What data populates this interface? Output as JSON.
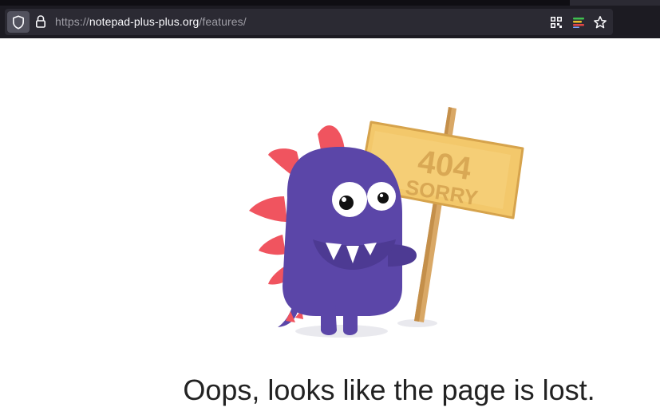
{
  "browser": {
    "url_scheme": "https://",
    "url_host": "notepad-plus-plus.org",
    "url_path": "/features/",
    "icons": {
      "tracking": "shield-icon",
      "secure": "lock-icon",
      "ext1": "qr-code-icon",
      "ext2": "color-bars-icon",
      "bookmark": "star-icon"
    }
  },
  "page": {
    "sign_code": "404",
    "sign_text": "SORRY",
    "message": "Oops, looks like the page is lost.",
    "colors": {
      "monster": "#5b46a8",
      "spikes": "#f0545f",
      "sign": "#f3c86b",
      "text": "#222222"
    }
  }
}
